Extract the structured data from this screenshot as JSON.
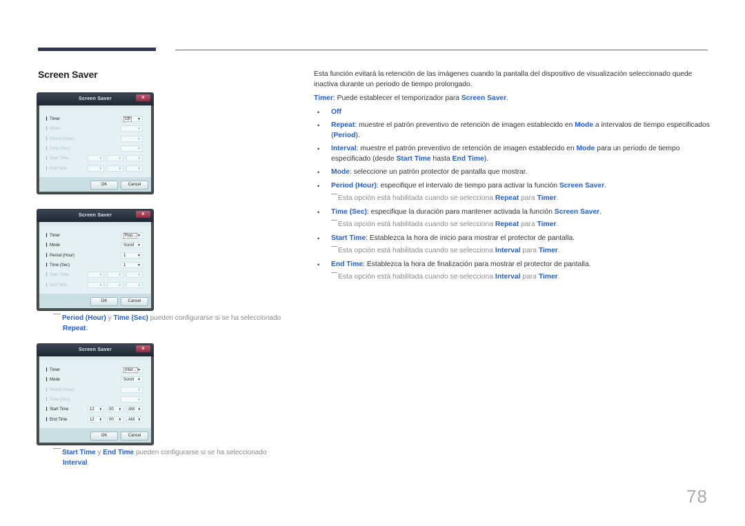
{
  "header": {
    "section_title": "Screen Saver"
  },
  "page_number": "78",
  "dialogs": [
    {
      "title": "Screen Saver",
      "close_label": "x",
      "rows": [
        {
          "label": "Timer",
          "enabled": true,
          "value": "Off",
          "type": "select"
        },
        {
          "label": "Mode",
          "enabled": false,
          "value": "",
          "type": "select"
        },
        {
          "label": "Period (Hour)",
          "enabled": false,
          "value": "",
          "type": "select"
        },
        {
          "label": "Time (Sec)",
          "enabled": false,
          "value": "",
          "type": "select"
        },
        {
          "label": "Start Time",
          "enabled": false,
          "values": [
            "",
            "",
            ""
          ],
          "type": "spin"
        },
        {
          "label": "End Time",
          "enabled": false,
          "values": [
            "",
            "",
            ""
          ],
          "type": "spin"
        }
      ],
      "ok_label": "OK",
      "cancel_label": "Cancel"
    },
    {
      "title": "Screen Saver",
      "close_label": "x",
      "rows": [
        {
          "label": "Timer",
          "enabled": true,
          "value": "Rep...",
          "type": "select"
        },
        {
          "label": "Mode",
          "enabled": true,
          "value": "Scroll",
          "type": "select"
        },
        {
          "label": "Period (Hour)",
          "enabled": true,
          "value": "1",
          "type": "select"
        },
        {
          "label": "Time (Sec)",
          "enabled": true,
          "value": "1",
          "type": "select"
        },
        {
          "label": "Start Time",
          "enabled": false,
          "values": [
            "",
            "",
            ""
          ],
          "type": "spin"
        },
        {
          "label": "End Time",
          "enabled": false,
          "values": [
            "",
            "",
            ""
          ],
          "type": "spin"
        }
      ],
      "ok_label": "OK",
      "cancel_label": "Cancel"
    },
    {
      "title": "Screen Saver",
      "close_label": "x",
      "rows": [
        {
          "label": "Timer",
          "enabled": true,
          "value": "Inter...",
          "type": "select"
        },
        {
          "label": "Mode",
          "enabled": true,
          "value": "Scroll",
          "type": "select"
        },
        {
          "label": "Period (Hour)",
          "enabled": false,
          "value": "",
          "type": "select"
        },
        {
          "label": "Time (Sec)",
          "enabled": false,
          "value": "",
          "type": "select"
        },
        {
          "label": "Start Time",
          "enabled": true,
          "values": [
            "12",
            "00",
            "AM"
          ],
          "type": "spin"
        },
        {
          "label": "End Time",
          "enabled": true,
          "values": [
            "12",
            "00",
            "AM"
          ],
          "type": "spin"
        }
      ],
      "ok_label": "OK",
      "cancel_label": "Cancel"
    }
  ],
  "notes": [
    {
      "parts": [
        {
          "text": "Period (Hour)",
          "kw": true
        },
        {
          "text": " y ",
          "kw": false
        },
        {
          "text": "Time (Sec)",
          "kw": true
        },
        {
          "text": " pueden configurarse si se ha seleccionado",
          "kw": false
        }
      ],
      "line2": [
        {
          "text": "Repeat",
          "kw": true
        },
        {
          "text": ".",
          "kw": false
        }
      ]
    },
    {
      "parts": [
        {
          "text": "Start Time",
          "kw": true
        },
        {
          "text": " y ",
          "kw": false
        },
        {
          "text": "End Time",
          "kw": true
        },
        {
          "text": " pueden configurarse si se ha seleccionado",
          "kw": false
        }
      ],
      "line2": [
        {
          "text": "Interval",
          "kw": true
        },
        {
          "text": ".",
          "kw": false
        }
      ]
    }
  ],
  "description": {
    "intro": "Esta función evitará la retención de las imágenes cuando la pantalla del dispositivo de visualización seleccionado quede inactiva durante un periodo de tiempo prolongado.",
    "timer_line": [
      {
        "text": "Timer",
        "kw": true
      },
      {
        "text": ": Puede establecer el temporizador para ",
        "kw": false
      },
      {
        "text": "Screen Saver",
        "kw": true
      },
      {
        "text": ".",
        "kw": false
      }
    ],
    "items": [
      {
        "parts": [
          {
            "text": "Off",
            "kw": true
          }
        ]
      },
      {
        "parts": [
          {
            "text": "Repeat",
            "kw": true
          },
          {
            "text": ": muestre el patrón preventivo de retención de imagen establecido en ",
            "kw": false
          },
          {
            "text": "Mode",
            "kw": true
          },
          {
            "text": " a intervalos de tiempo especificados (",
            "kw": false
          },
          {
            "text": "Period",
            "kw": true
          },
          {
            "text": ").",
            "kw": false
          }
        ]
      },
      {
        "parts": [
          {
            "text": "Interval",
            "kw": true
          },
          {
            "text": ": muestre el patrón preventivo de retención de imagen establecido en ",
            "kw": false
          },
          {
            "text": "Mode",
            "kw": true
          },
          {
            "text": " para un periodo de tiempo especificado (desde ",
            "kw": false
          },
          {
            "text": "Start Time",
            "kw": true
          },
          {
            "text": " hasta ",
            "kw": false
          },
          {
            "text": "End Time",
            "kw": true
          },
          {
            "text": ").",
            "kw": false
          }
        ]
      },
      {
        "parts": [
          {
            "text": "Mode",
            "kw": true
          },
          {
            "text": ": seleccione un patrón protector de pantalla que mostrar.",
            "kw": false
          }
        ]
      },
      {
        "parts": [
          {
            "text": "Period (Hour)",
            "kw": true
          },
          {
            "text": ": especifique el intervalo de tiempo para activar la función ",
            "kw": false
          },
          {
            "text": "Screen Saver",
            "kw": true
          },
          {
            "text": ".",
            "kw": false
          }
        ],
        "note": [
          {
            "text": "Esta opción está habilitada cuando se selecciona ",
            "kw": false
          },
          {
            "text": "Repeat",
            "kw": true
          },
          {
            "text": " para ",
            "kw": false
          },
          {
            "text": "Timer",
            "kw": true
          },
          {
            "text": ".",
            "kw": false
          }
        ]
      },
      {
        "parts": [
          {
            "text": "Time (Sec)",
            "kw": true
          },
          {
            "text": ": especifique la duración para mantener activada la función ",
            "kw": false
          },
          {
            "text": "Screen Saver",
            "kw": true
          },
          {
            "text": ".",
            "kw": false
          }
        ],
        "note": [
          {
            "text": "Esta opción está habilitada cuando se selecciona ",
            "kw": false
          },
          {
            "text": "Repeat",
            "kw": true
          },
          {
            "text": " para ",
            "kw": false
          },
          {
            "text": "Timer",
            "kw": true
          },
          {
            "text": ".",
            "kw": false
          }
        ]
      },
      {
        "parts": [
          {
            "text": "Start Time",
            "kw": true
          },
          {
            "text": ": Establezca la hora de inicio para mostrar el protector de pantalla.",
            "kw": false
          }
        ],
        "note": [
          {
            "text": "Esta opción está habilitada cuando se selecciona ",
            "kw": false
          },
          {
            "text": "Interval",
            "kw": true
          },
          {
            "text": " para ",
            "kw": false
          },
          {
            "text": "Timer",
            "kw": true
          },
          {
            "text": ".",
            "kw": false
          }
        ]
      },
      {
        "parts": [
          {
            "text": "End Time",
            "kw": true
          },
          {
            "text": ": Establezca la hora de finalización para mostrar el protector de pantalla.",
            "kw": false
          }
        ],
        "note": [
          {
            "text": "Esta opción está habilitada cuando se selecciona ",
            "kw": false
          },
          {
            "text": "Interval",
            "kw": true
          },
          {
            "text": " para ",
            "kw": false
          },
          {
            "text": "Timer",
            "kw": true
          },
          {
            "text": ".",
            "kw": false
          }
        ]
      }
    ]
  },
  "colors": {
    "keyword": "#1f5fd6",
    "header_bar": "#2f3452",
    "muted_text": "#8a8a8a"
  }
}
